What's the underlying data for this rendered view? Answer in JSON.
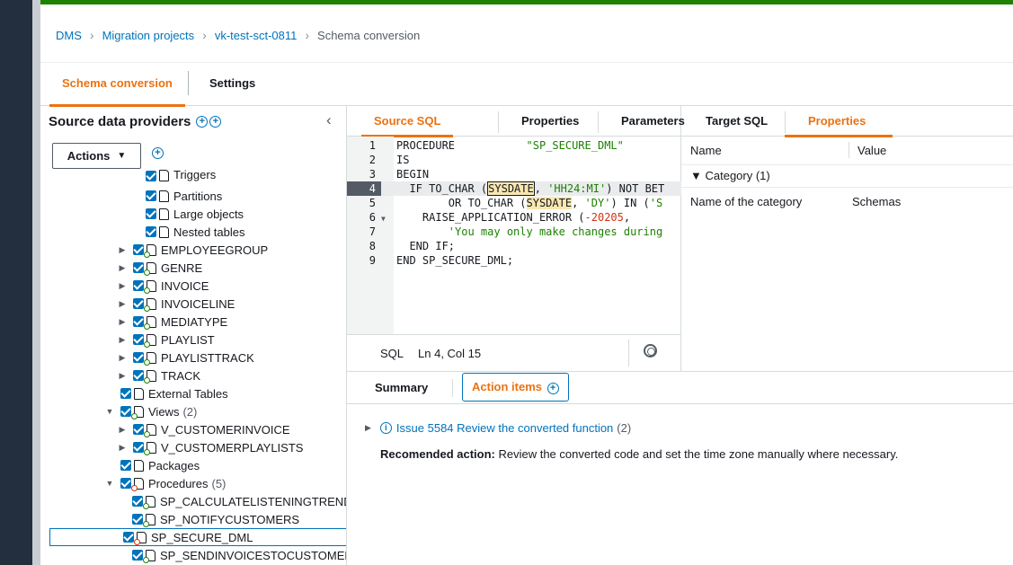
{
  "breadcrumb": [
    "DMS",
    "Migration projects",
    "vk-test-sct-0811",
    "Schema conversion"
  ],
  "top_tabs": {
    "schema": "Schema conversion",
    "settings": "Settings"
  },
  "left": {
    "title": "Source data providers",
    "actions": "Actions",
    "tree": [
      {
        "label": "Triggers"
      },
      {
        "label": "Partitions"
      },
      {
        "label": "Large objects"
      },
      {
        "label": "Nested tables"
      },
      {
        "label": "EMPLOYEEGROUP"
      },
      {
        "label": "GENRE"
      },
      {
        "label": "INVOICE"
      },
      {
        "label": "INVOICELINE"
      },
      {
        "label": "MEDIATYPE"
      },
      {
        "label": "PLAYLIST"
      },
      {
        "label": "PLAYLISTTRACK"
      },
      {
        "label": "TRACK"
      },
      {
        "label": "External Tables"
      },
      {
        "label": "Views",
        "count": "(2)"
      },
      {
        "label": "V_CUSTOMERINVOICE"
      },
      {
        "label": "V_CUSTOMERPLAYLISTS"
      },
      {
        "label": "Packages"
      },
      {
        "label": "Procedures",
        "count": "(5)"
      },
      {
        "label": "SP_CALCULATELISTENINGTRENDS"
      },
      {
        "label": "SP_NOTIFYCUSTOMERS"
      },
      {
        "label": "SP_SECURE_DML"
      },
      {
        "label": "SP_SENDINVOICESTOCUSTOMERS"
      }
    ]
  },
  "source_tabs": {
    "source_sql": "Source SQL",
    "properties": "Properties",
    "parameters": "Parameters"
  },
  "code": {
    "line_numbers": [
      "1",
      "2",
      "3",
      "4",
      "5",
      "6",
      "7",
      "8",
      "9"
    ],
    "l1a": "PROCEDURE           ",
    "l1b": "\"SP_SECURE_DML\"",
    "l2": "IS",
    "l3": "BEGIN",
    "l4a": "  IF TO_CHAR (",
    "l4b": "SYSDATE",
    "l4c": ", ",
    "l4d": "'HH24:MI'",
    "l4e": ") NOT BET",
    "l5a": "        OR TO_CHAR (",
    "l5b": "SYSDATE",
    "l5c": ", ",
    "l5d": "'DY'",
    "l5e": ") IN (",
    "l5f": "'S",
    "l6a": "    RAISE_APPLICATION_ERROR (",
    "l6b": "-20205",
    "l6c": ",",
    "l7": "        'You may only make changes during",
    "l8": "  END IF;",
    "l9": "END SP_SECURE_DML;"
  },
  "status": {
    "lang": "SQL",
    "pos": "Ln 4, Col 15"
  },
  "target_tabs": {
    "target_sql": "Target SQL",
    "properties": "Properties"
  },
  "props": {
    "name_header": "Name",
    "value_header": "Value",
    "category": "▼ Category (1)",
    "row_name": "Name of the category",
    "row_value": "Schemas"
  },
  "bottom_tabs": {
    "summary": "Summary",
    "action_items": "Action items"
  },
  "issue": {
    "link": "Issue 5584 Review the converted function",
    "count": "(2)"
  },
  "recommendation": {
    "label": "Recomended action:",
    "text": " Review the converted code and set the time zone manually where necessary."
  },
  "colors": {
    "accent": "#ec7211",
    "link": "#0073bb",
    "top_bar": "#1d8102"
  }
}
